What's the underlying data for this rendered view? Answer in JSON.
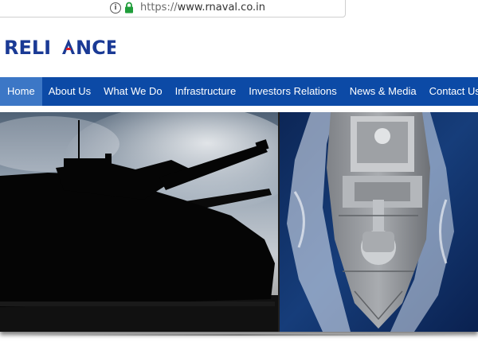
{
  "browser": {
    "url_scheme": "https://",
    "url_host": "www.rnaval.co.in",
    "info_icon": "info-icon",
    "lock_icon": "lock-icon",
    "lock_color": "#1f9d3a"
  },
  "header": {
    "logo_text_left": "RELI",
    "logo_text_right": "NCE",
    "brand_color": "#1a3a95",
    "accent_color": "#e21b23"
  },
  "nav": {
    "background": "#0c4aa6",
    "active_background": "#3c77c6",
    "items": [
      {
        "label": "Home",
        "active": true
      },
      {
        "label": "About Us",
        "active": false
      },
      {
        "label": "What We Do",
        "active": false
      },
      {
        "label": "Infrastructure",
        "active": false
      },
      {
        "label": "Investors Relations",
        "active": false
      },
      {
        "label": "News & Media",
        "active": false
      },
      {
        "label": "Contact Us",
        "active": false
      }
    ]
  },
  "banner": {
    "left_image": "tank-silhouette-image",
    "right_image": "naval-ship-image"
  }
}
